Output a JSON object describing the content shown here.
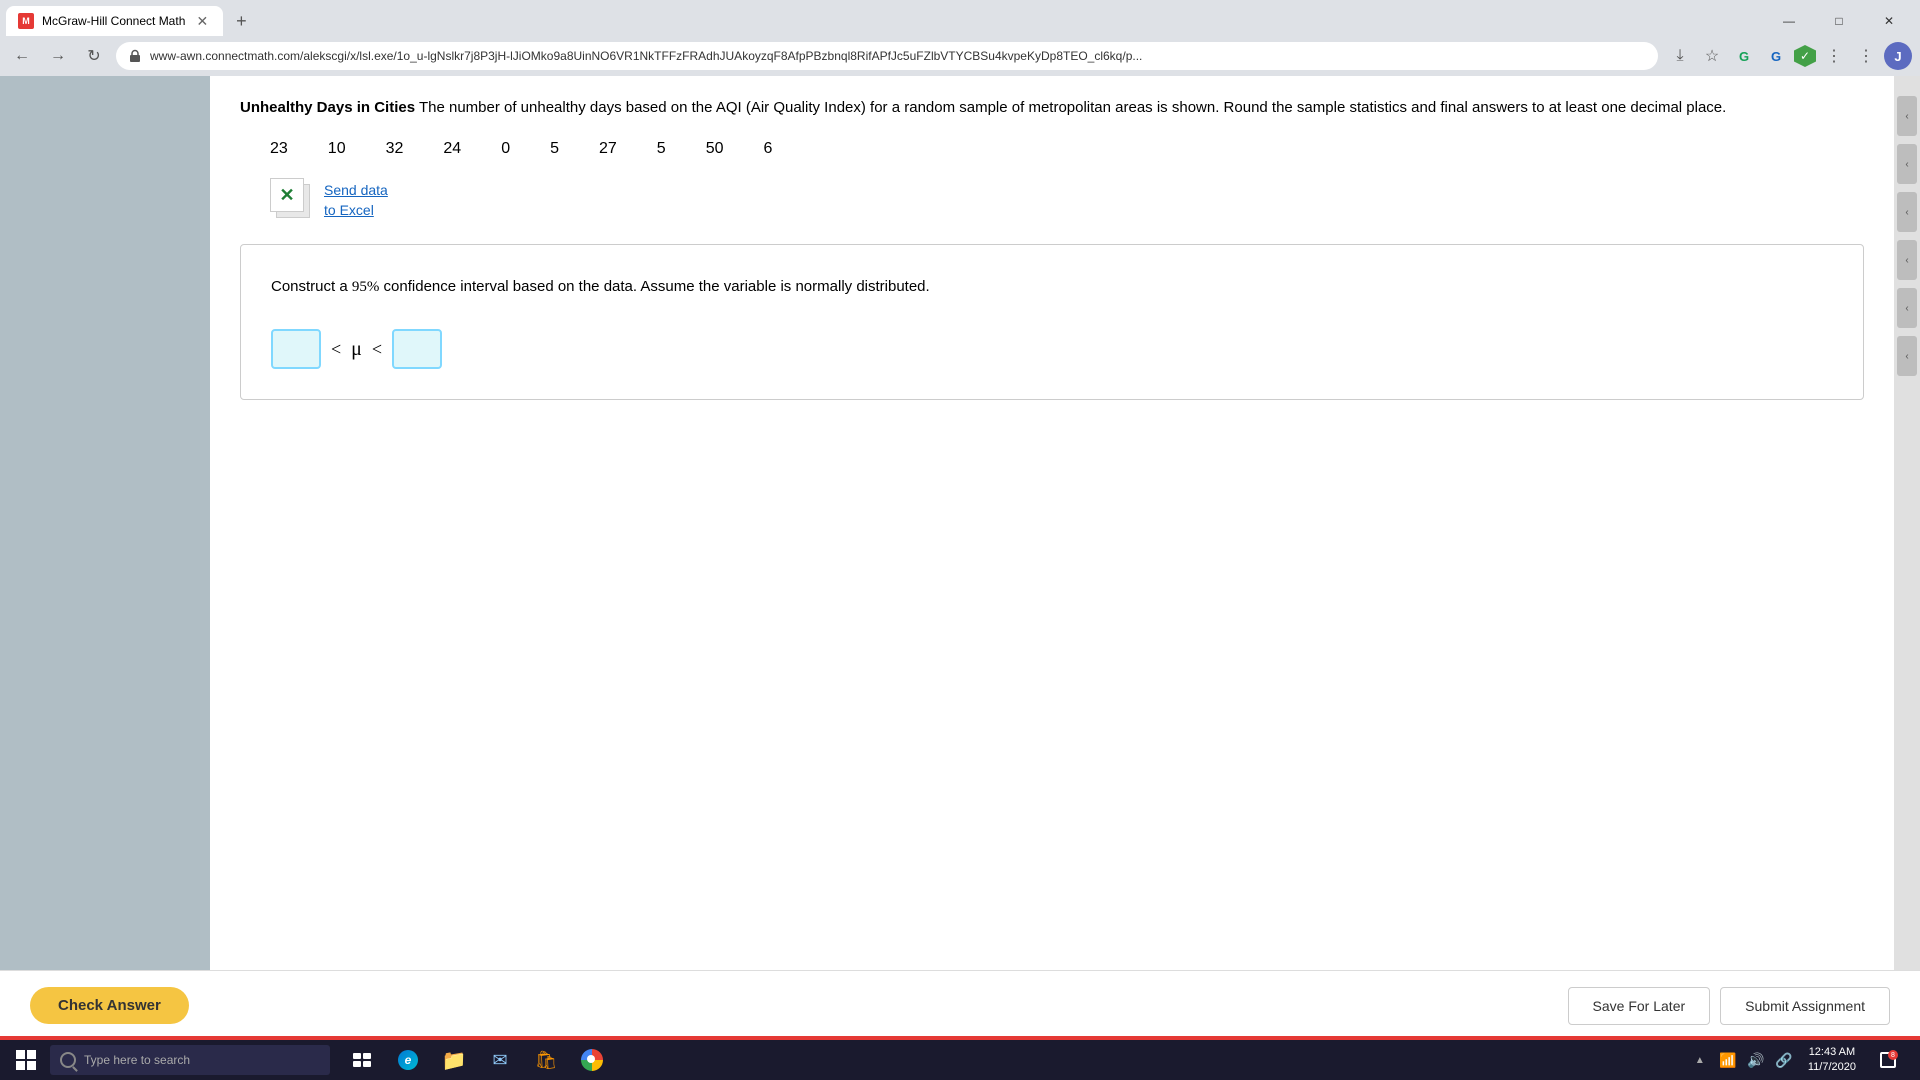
{
  "browser": {
    "tab_label": "McGraw-Hill Connect Math",
    "url": "www-awn.connectmath.com/alekscgi/x/lsl.exe/1o_u-lgNslkr7j8P3jH-lJiOMko9a8UinNO6VR1NkTFFzFRAdhJUAkoyzqF8AfpPBzbnql8RifAPfJc5uFZlbVTYCBSu4kvpeKyDp8TEO_cl6kq/p...",
    "new_tab_btn": "+",
    "back": "←",
    "forward": "→",
    "refresh": "↻",
    "window_minimize": "—",
    "window_maximize": "□",
    "window_close": "✕",
    "profile_initial": "J"
  },
  "problem": {
    "title_bold": "Unhealthy Days in Cities",
    "title_text": " The number of unhealthy days based on the AQI (Air Quality Index) for a random sample of metropolitan areas is shown. Round the sample statistics and final answers to at least one decimal place.",
    "data_values": [
      "23",
      "10",
      "32",
      "24",
      "0",
      "5",
      "27",
      "5",
      "50",
      "6"
    ],
    "send_data_line1": "Send data",
    "send_data_line2": "to Excel",
    "question_text": "Construct a 95% confidence interval based on the data. Assume the variable is normally distributed.",
    "confidence_pct": "95%",
    "mu_less_than": "< μ <",
    "input1_placeholder": "",
    "input2_placeholder": ""
  },
  "footer": {
    "check_answer": "Check Answer",
    "save_later": "Save For Later",
    "submit": "Submit Assignment"
  },
  "taskbar": {
    "search_placeholder": "Type here to search",
    "time": "12:43 AM",
    "date": "11/7/2020"
  },
  "right_sidebar": {
    "arrows": [
      "‹",
      "‹",
      "‹",
      "‹",
      "‹",
      "‹"
    ]
  }
}
